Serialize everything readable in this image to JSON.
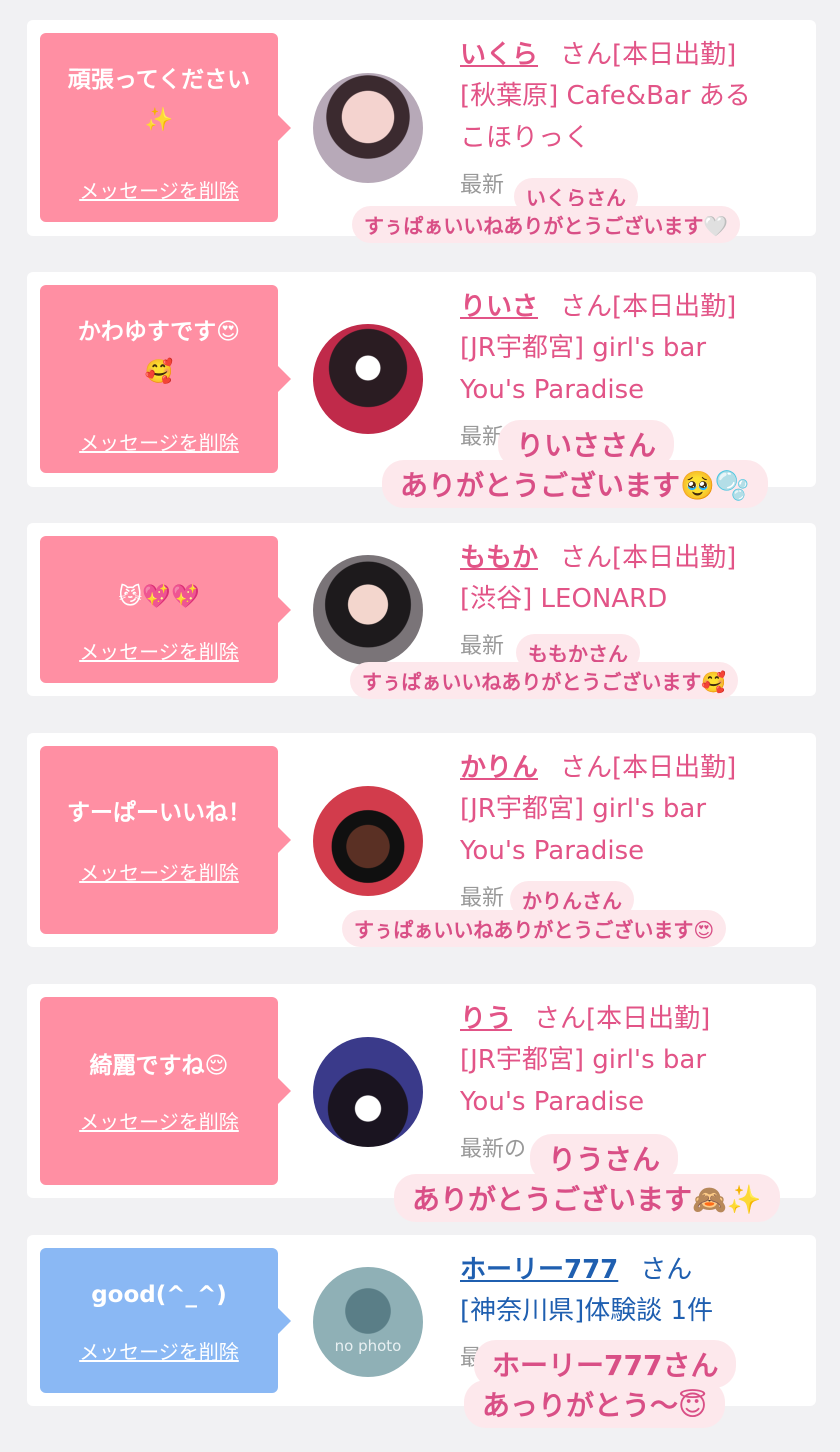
{
  "delete_label": "メッセージを削除",
  "san_label": "さん",
  "on_duty": "[本日出勤]",
  "cards": [
    {
      "msg1": "頑張ってください",
      "msg2": "✨",
      "name": "いくら",
      "shop1": "[秋葉原] Cafe&Bar ある",
      "shop2": "こほりっく",
      "latest": "最新",
      "ov_title": "いくらさん",
      "ov_body": "すぅぱぁいいねありがとうございます🤍",
      "color": "pink"
    },
    {
      "msg1": "かわゆすです😍",
      "msg2": "🥰",
      "name": "りいさ",
      "shop1": "[JR宇都宮] girl's bar",
      "shop2": "You's Paradise",
      "latest": "最新",
      "ov_title": "りいささん",
      "ov_body": "ありがとうございます🥹🫧",
      "color": "pink"
    },
    {
      "msg1": "😼💖💖",
      "msg2": "",
      "name": "ももか",
      "shop1": "[渋谷] LEONARD",
      "shop2": "",
      "latest": "最新",
      "ov_title": "ももかさん",
      "ov_body": "すぅぱぁいいねありがとうございます🥰",
      "color": "pink"
    },
    {
      "msg1": "すーぱーいいね！",
      "msg2": "",
      "name": "かりん",
      "shop1": "[JR宇都宮] girl's bar",
      "shop2": "You's Paradise",
      "latest": "最新",
      "ov_title": "かりんさん",
      "ov_body": "すぅぱぁいいねありがとうございます😍",
      "color": "pink"
    },
    {
      "msg1": "綺麗ですね😌",
      "msg2": "",
      "name": "りう",
      "shop1": "[JR宇都宮] girl's bar",
      "shop2": "You's Paradise",
      "latest": "最新の",
      "ov_title": "りうさん",
      "ov_body": "ありがとうございます🙈✨",
      "color": "pink"
    },
    {
      "msg1": "good(^_^)",
      "msg2": "",
      "name": "ホーリー777",
      "shop1": "[神奈川県]体験談 1件",
      "shop2": "",
      "latest": "最",
      "ov_title": "ホーリー777さん",
      "ov_body": "あっりがとう〜😇",
      "color": "blue",
      "avatar_text": "no photo"
    }
  ],
  "colors": {
    "pink": "#ff8fa3",
    "blue": "#8ab8f4",
    "name_pink": "#e25487",
    "name_blue": "#1f5fb0"
  }
}
